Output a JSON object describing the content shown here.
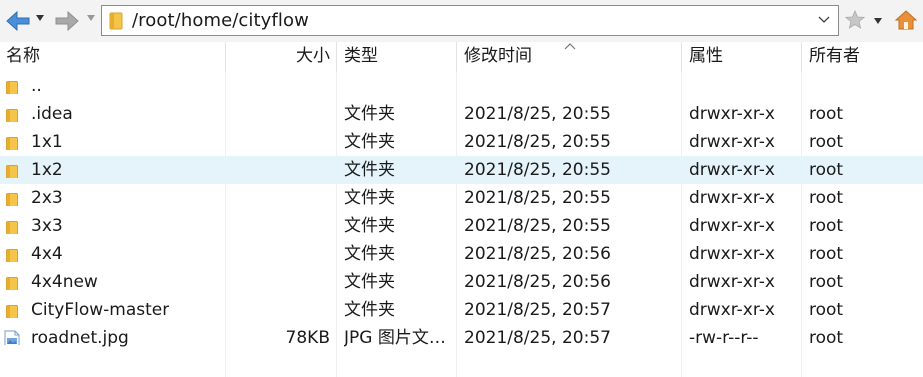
{
  "toolbar": {
    "path": "/root/home/cityflow",
    "icons": [
      "back-arrow-icon",
      "forward-arrow-icon",
      "folder-icon",
      "chevron-down-icon",
      "star-icon",
      "home-icon"
    ]
  },
  "columns": {
    "name": "名称",
    "size": "大小",
    "type": "类型",
    "modified": "修改时间",
    "permissions": "属性",
    "owner": "所有者"
  },
  "colors": {
    "accent_back": "#4a8fd8",
    "folder": "#f5c54a",
    "selected_row": "#e5f3fb",
    "home": "#e8913a"
  },
  "files": [
    {
      "name": "..",
      "size": "",
      "type": "",
      "modified": "",
      "permissions": "",
      "owner": "",
      "icon": "folder-icon"
    },
    {
      "name": ".idea",
      "size": "",
      "type": "文件夹",
      "modified": "2021/8/25, 20:55",
      "permissions": "drwxr-xr-x",
      "owner": "root",
      "icon": "folder-icon"
    },
    {
      "name": "1x1",
      "size": "",
      "type": "文件夹",
      "modified": "2021/8/25, 20:55",
      "permissions": "drwxr-xr-x",
      "owner": "root",
      "icon": "folder-icon"
    },
    {
      "name": "1x2",
      "size": "",
      "type": "文件夹",
      "modified": "2021/8/25, 20:55",
      "permissions": "drwxr-xr-x",
      "owner": "root",
      "icon": "folder-icon",
      "selected": true
    },
    {
      "name": "2x3",
      "size": "",
      "type": "文件夹",
      "modified": "2021/8/25, 20:55",
      "permissions": "drwxr-xr-x",
      "owner": "root",
      "icon": "folder-icon"
    },
    {
      "name": "3x3",
      "size": "",
      "type": "文件夹",
      "modified": "2021/8/25, 20:55",
      "permissions": "drwxr-xr-x",
      "owner": "root",
      "icon": "folder-icon"
    },
    {
      "name": "4x4",
      "size": "",
      "type": "文件夹",
      "modified": "2021/8/25, 20:56",
      "permissions": "drwxr-xr-x",
      "owner": "root",
      "icon": "folder-icon"
    },
    {
      "name": "4x4new",
      "size": "",
      "type": "文件夹",
      "modified": "2021/8/25, 20:56",
      "permissions": "drwxr-xr-x",
      "owner": "root",
      "icon": "folder-icon"
    },
    {
      "name": "CityFlow-master",
      "size": "",
      "type": "文件夹",
      "modified": "2021/8/25, 20:57",
      "permissions": "drwxr-xr-x",
      "owner": "root",
      "icon": "folder-icon"
    },
    {
      "name": "roadnet.jpg",
      "size": "78KB",
      "type": "JPG 图片文…",
      "modified": "2021/8/25, 20:57",
      "permissions": "-rw-r--r--",
      "owner": "root",
      "icon": "image-file-icon"
    }
  ]
}
